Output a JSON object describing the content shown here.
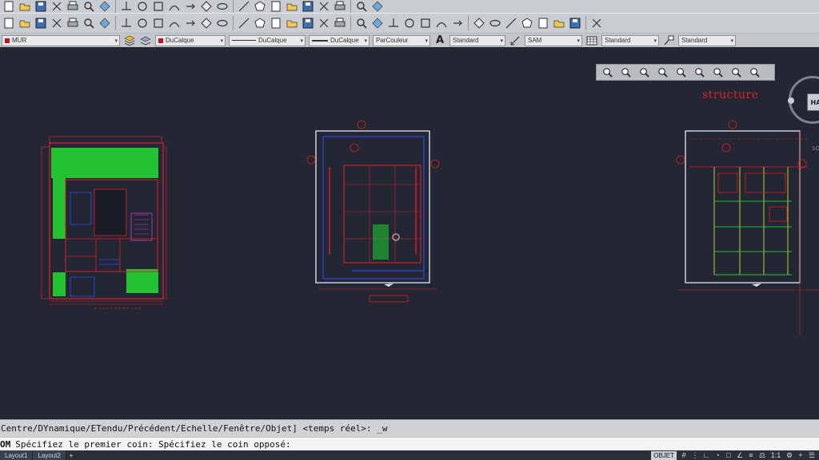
{
  "toolbar": {
    "layer_combo": {
      "value": "MUR",
      "swatch_color": "#c1121c"
    },
    "color_combo": {
      "value": "DuCalque",
      "swatch_color": "#c1121c"
    },
    "linetype_combo": {
      "value": "DuCalque"
    },
    "lineweight_combo": {
      "value": "DuCalque"
    },
    "plotstyle_combo": {
      "value": "ParCouleur"
    },
    "text_style_combo": {
      "value": "Standard"
    },
    "dim_style_combo": {
      "value": "SAM"
    },
    "table_style_combo": {
      "value": "Standard"
    },
    "mleader_style_combo": {
      "value": "Standard"
    }
  },
  "canvas": {
    "background": "#222733",
    "label": "structure"
  },
  "viewcube": {
    "face_label": "HA",
    "south_label": "SO"
  },
  "command": {
    "history_line": "Centre/DYnamique/ETendu/Précédent/Echelle/Fenêtre/Objet] <temps réel>: _w",
    "prompt_prefix": "OM",
    "prompt_text": "Spécifiez le premier coin: Spécifiez le coin opposé:"
  },
  "statusbar": {
    "tabs": [
      "Layout1",
      "Layout2"
    ],
    "plus": "+",
    "objet": "OBJET",
    "scale": "1:1"
  },
  "icons": {
    "row1": [
      "new-icon",
      "open-icon",
      "save-icon",
      "saveas-icon",
      "plot-icon",
      "preview-icon",
      "publish-icon",
      "cut-icon",
      "copy-icon",
      "paste-icon",
      "matchprop-icon",
      "undo-icon",
      "redo-icon",
      "pan-icon",
      "zoom-realtime-icon",
      "zoom-window-icon",
      "zoom-previous-icon",
      "properties-icon",
      "designcenter-icon",
      "toolpalette-icon",
      "sheetset-icon",
      "markup-icon",
      "calculator-icon"
    ],
    "row2": [
      "erase-icon",
      "copy-object-icon",
      "mirror-icon",
      "offset-icon",
      "array-icon",
      "move-icon",
      "rotate-icon",
      "scale-icon",
      "stretch-icon",
      "trim-icon",
      "extend-icon",
      "break-icon",
      "join-icon",
      "chamfer-icon",
      "fillet-icon",
      "explode-icon",
      "line-icon",
      "xline-icon",
      "polyline-icon",
      "polygon-icon",
      "rectangle-icon",
      "arc-icon",
      "circle-icon",
      "revcloud-icon",
      "spline-icon",
      "ellipse-icon",
      "ellipse-arc-icon",
      "insert-block-icon",
      "make-block-icon",
      "point-icon",
      "hatch-icon",
      "gradient-icon",
      "region-icon",
      "table-icon",
      "mtext-icon",
      "add-selected-icon"
    ]
  }
}
